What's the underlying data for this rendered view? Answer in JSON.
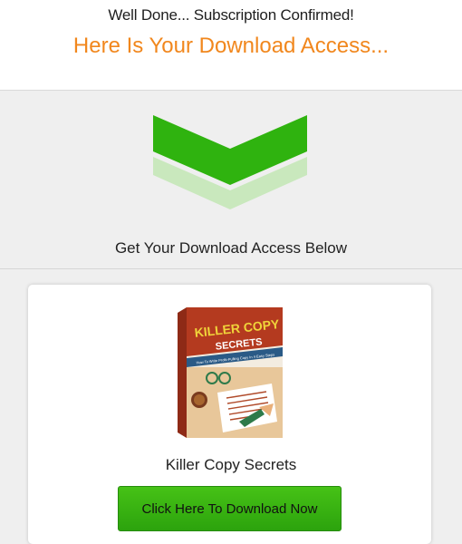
{
  "header": {
    "headline": "Well Done... Subscription Confirmed!",
    "subheadline": "Here Is Your Download Access..."
  },
  "access": {
    "title": "Get Your Download Access Below",
    "arrow_icon": "chevron-down-icon",
    "colors": {
      "arrow_primary": "#2fb30f",
      "arrow_secondary": "#c9e8bd"
    }
  },
  "product": {
    "cover": {
      "title_line1": "KILLER COPY",
      "title_line2": "SECRETS",
      "tagline": "How To Write Profit-Pulling Copy In 4 Easy Steps"
    },
    "name": "Killer Copy Secrets",
    "download_label": "Click Here To Download Now"
  },
  "colors": {
    "accent_orange": "#f1871d",
    "button_green": "#3bb412",
    "band_gray": "#efefef"
  }
}
